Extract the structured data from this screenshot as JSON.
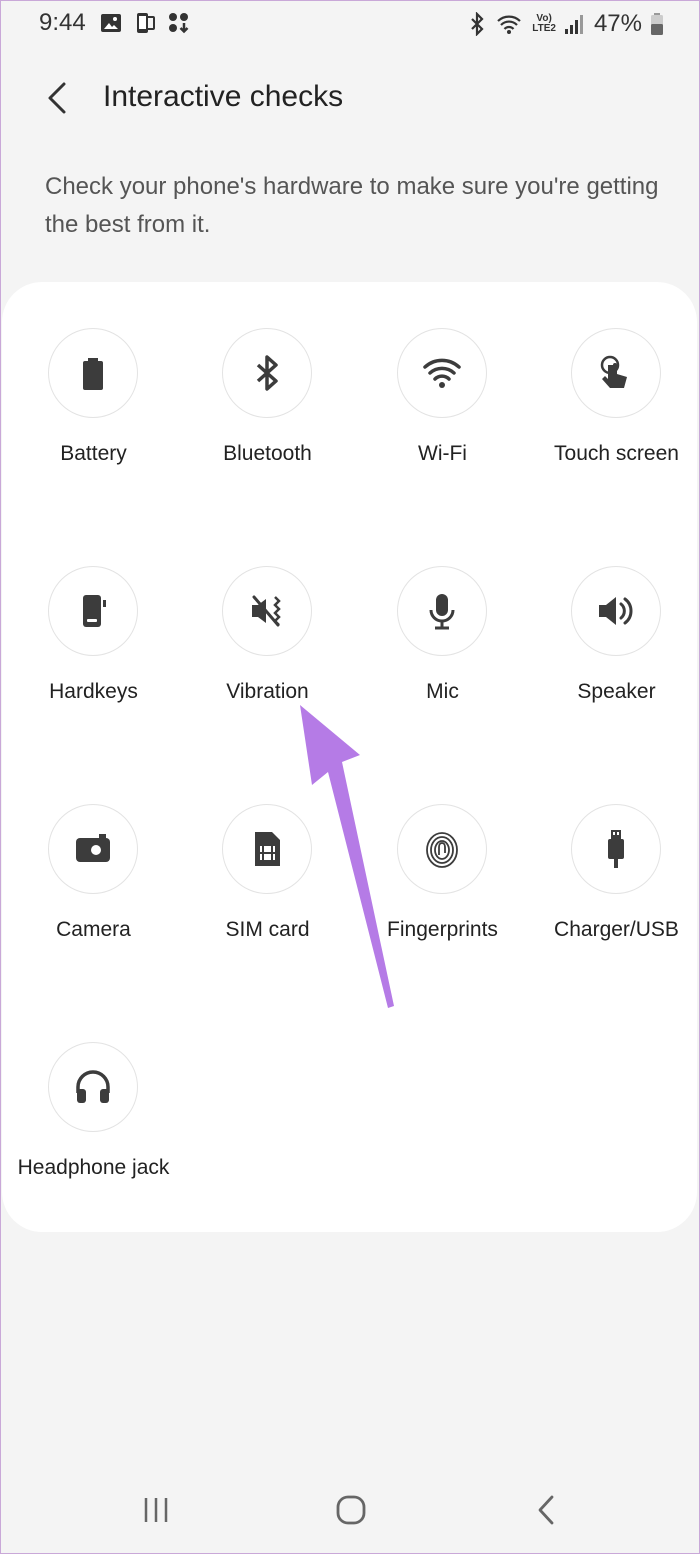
{
  "status_bar": {
    "time": "9:44",
    "battery_percent": "47%",
    "volte_top": "Vo)",
    "volte_bottom": "LTE2",
    "left_icons": [
      "gallery-icon",
      "screenshot-icon",
      "apps-download-icon"
    ],
    "right_icons": [
      "bluetooth-icon",
      "wifi-call-icon",
      "signal-icon",
      "battery-icon"
    ]
  },
  "header": {
    "title": "Interactive checks",
    "back_icon": "chevron-left-icon"
  },
  "description": "Check your phone's hardware to make sure you're getting the best from it.",
  "checks": [
    {
      "label": "Battery",
      "icon": "battery-icon"
    },
    {
      "label": "Bluetooth",
      "icon": "bluetooth-icon"
    },
    {
      "label": "Wi-Fi",
      "icon": "wifi-icon"
    },
    {
      "label": "Touch screen",
      "icon": "touch-icon"
    },
    {
      "label": "Hardkeys",
      "icon": "hardkeys-icon"
    },
    {
      "label": "Vibration",
      "icon": "vibration-icon"
    },
    {
      "label": "Mic",
      "icon": "mic-icon"
    },
    {
      "label": "Speaker",
      "icon": "speaker-icon"
    },
    {
      "label": "Camera",
      "icon": "camera-icon"
    },
    {
      "label": "SIM card",
      "icon": "sim-card-icon"
    },
    {
      "label": "Fingerprints",
      "icon": "fingerprint-icon"
    },
    {
      "label": "Charger/USB",
      "icon": "usb-icon"
    },
    {
      "label": "Headphone jack",
      "icon": "headphones-icon"
    }
  ],
  "nav_bar": {
    "recents_icon": "recents-icon",
    "home_icon": "home-icon",
    "back_icon": "back-icon"
  },
  "colors": {
    "background": "#f4f4f4",
    "card": "#ffffff",
    "icon": "#3c3c3c",
    "arrow": "#b57be6"
  }
}
